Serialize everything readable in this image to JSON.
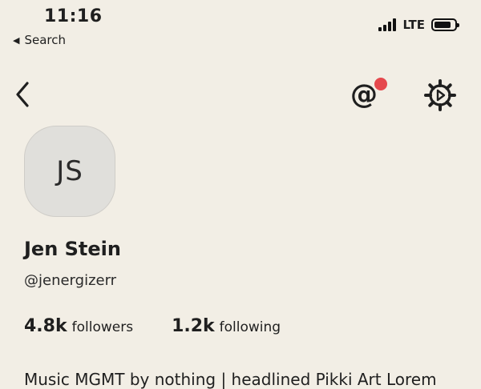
{
  "status_bar": {
    "time": "11:16",
    "back_label": "Search",
    "network": "LTE",
    "signal_bars": 4,
    "battery_level": 0.85
  },
  "header": {
    "back_icon": "chevron-left-icon",
    "mention_icon": "at-icon",
    "mention_glyph": "@",
    "settings_icon": "gear-icon",
    "notification_color": "#e5484d"
  },
  "profile": {
    "initials": "JS",
    "name": "Jen Stein",
    "handle": "@jenergizerr",
    "followers_count": "4.8k",
    "followers_label": "followers",
    "following_count": "1.2k",
    "following_label": "following",
    "bio_preview": "Music MGMT by nothing | headlined Pikki Art Lorem"
  },
  "colors": {
    "background": "#f2eee5",
    "avatar_bg": "#e0dfdb",
    "text": "#1f1f1f"
  }
}
